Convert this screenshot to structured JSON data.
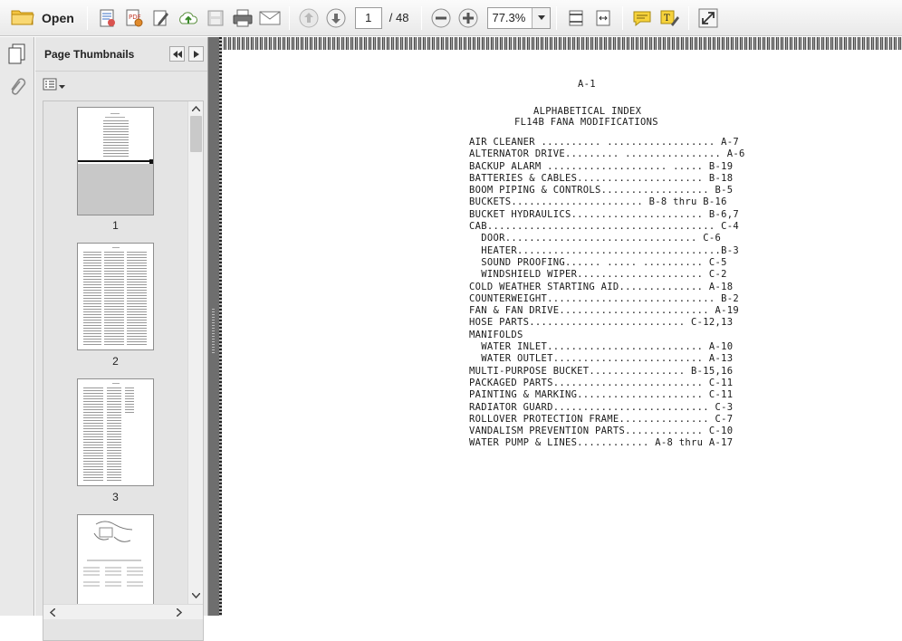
{
  "toolbar": {
    "open_label": "Open",
    "page_current": "1",
    "page_total": "/ 48",
    "zoom": "77.3%"
  },
  "panel": {
    "title": "Page Thumbnails",
    "thumbnails": [
      {
        "label": "1"
      },
      {
        "label": "2"
      },
      {
        "label": "3"
      }
    ]
  },
  "document": {
    "page_id": "A-1",
    "title_line1": "ALPHABETICAL INDEX",
    "title_line2": "FL14B FANA MODIFICATIONS",
    "entries": [
      "AIR CLEANER .......... .................. A-7",
      "ALTERNATOR DRIVE......... ................ A-6",
      "BACKUP ALARM .................... ..... B-19",
      "BATTERIES & CABLES..................... B-18",
      "BOOM PIPING & CONTROLS.................. B-5",
      "BUCKETS...................... B-8 thru B-16",
      "BUCKET HYDRAULICS...................... B-6,7",
      "CAB...................................... C-4",
      "  DOOR................................ C-6",
      "  HEATER..................................B-3",
      "  SOUND PROOFING...... ..... .......... C-5",
      "  WINDSHIELD WIPER..................... C-2",
      "COLD WEATHER STARTING AID.............. A-18",
      "COUNTERWEIGHT............................ B-2",
      "FAN & FAN DRIVE......................... A-19",
      "HOSE PARTS.......................... C-12,13",
      "MANIFOLDS",
      "  WATER INLET.......................... A-10",
      "  WATER OUTLET......................... A-13",
      "MULTI-PURPOSE BUCKET................ B-15,16",
      "PACKAGED PARTS......................... C-11",
      "PAINTING & MARKING..................... C-11",
      "RADIATOR GUARD.......................... C-3",
      "ROLLOVER PROTECTION FRAME............... C-7",
      "VANDALISM PREVENTION PARTS............. C-10",
      "WATER PUMP & LINES............ A-8 thru A-17"
    ]
  }
}
